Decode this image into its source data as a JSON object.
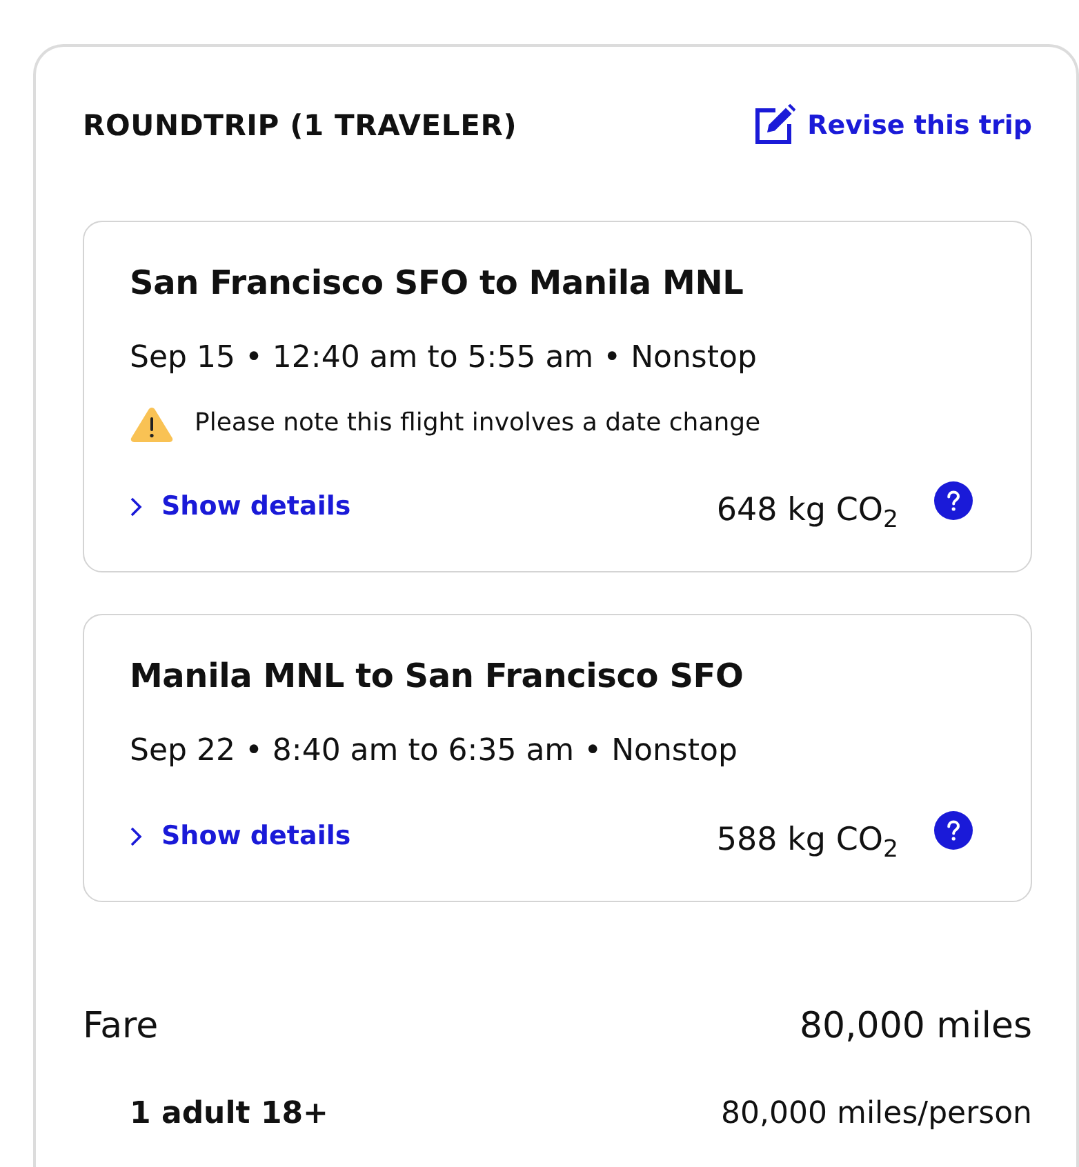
{
  "summary": {
    "title": "ROUNDTRIP (1 TRAVELER)",
    "revise_link": "Revise this trip"
  },
  "flights": [
    {
      "route": "San Francisco SFO to Manila MNL",
      "schedule": "Sep 15 • 12:40 am to 5:55 am • Nonstop",
      "warning": "Please note this flight involves a date change",
      "details_link": "Show details",
      "emissions": "648 kg CO$_{2}$"
    },
    {
      "route": "Manila MNL to San Francisco SFO",
      "schedule": "Sep 22 • 8:40 am to 6:35 am • Nonstop",
      "details_link": "Show details",
      "emissions": "588 kg CO$_{2}$"
    }
  ],
  "fare": {
    "label": "Fare",
    "total": "80,000 miles",
    "travelers": [
      {
        "label": "1 adult 18+",
        "price": "80,000 miles/person"
      }
    ]
  }
}
